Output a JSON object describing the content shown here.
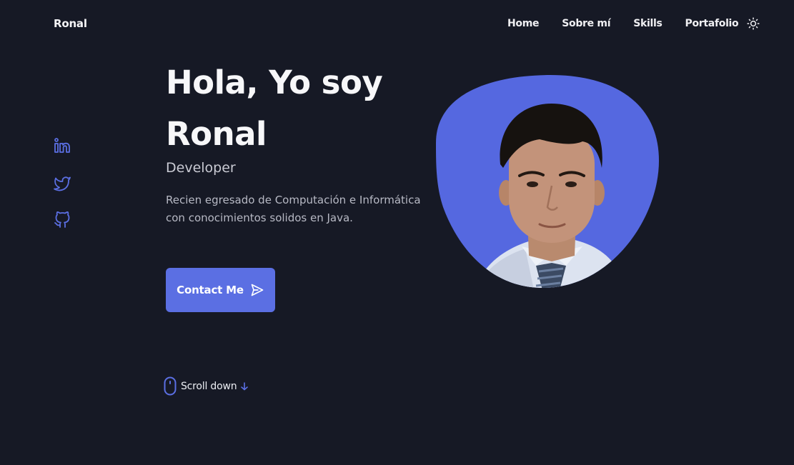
{
  "header": {
    "logo": "Ronal",
    "nav": [
      {
        "label": "Home"
      },
      {
        "label": "Sobre mí"
      },
      {
        "label": "Skills"
      },
      {
        "label": "Portafolio"
      }
    ],
    "theme_icon": "sun-icon"
  },
  "social": [
    {
      "icon": "linkedin-icon"
    },
    {
      "icon": "twitter-icon"
    },
    {
      "icon": "github-icon"
    }
  ],
  "hero": {
    "title_line1": "Hola, Yo soy",
    "title_line2": "Ronal",
    "subtitle": "Developer",
    "description": "Recien egresado de Computación e Informática con conocimientos solidos en Java.",
    "button_label": "Contact Me",
    "button_icon": "send-icon",
    "scroll_label": "Scroll down",
    "scroll_icons": [
      "mouse-icon",
      "arrow-down-icon"
    ],
    "profile_image": "profile-photo"
  },
  "colors": {
    "background": "#161925",
    "accent": "#5b6fe3",
    "title": "#f7f7f9",
    "text_muted": "#b7b9c4"
  }
}
